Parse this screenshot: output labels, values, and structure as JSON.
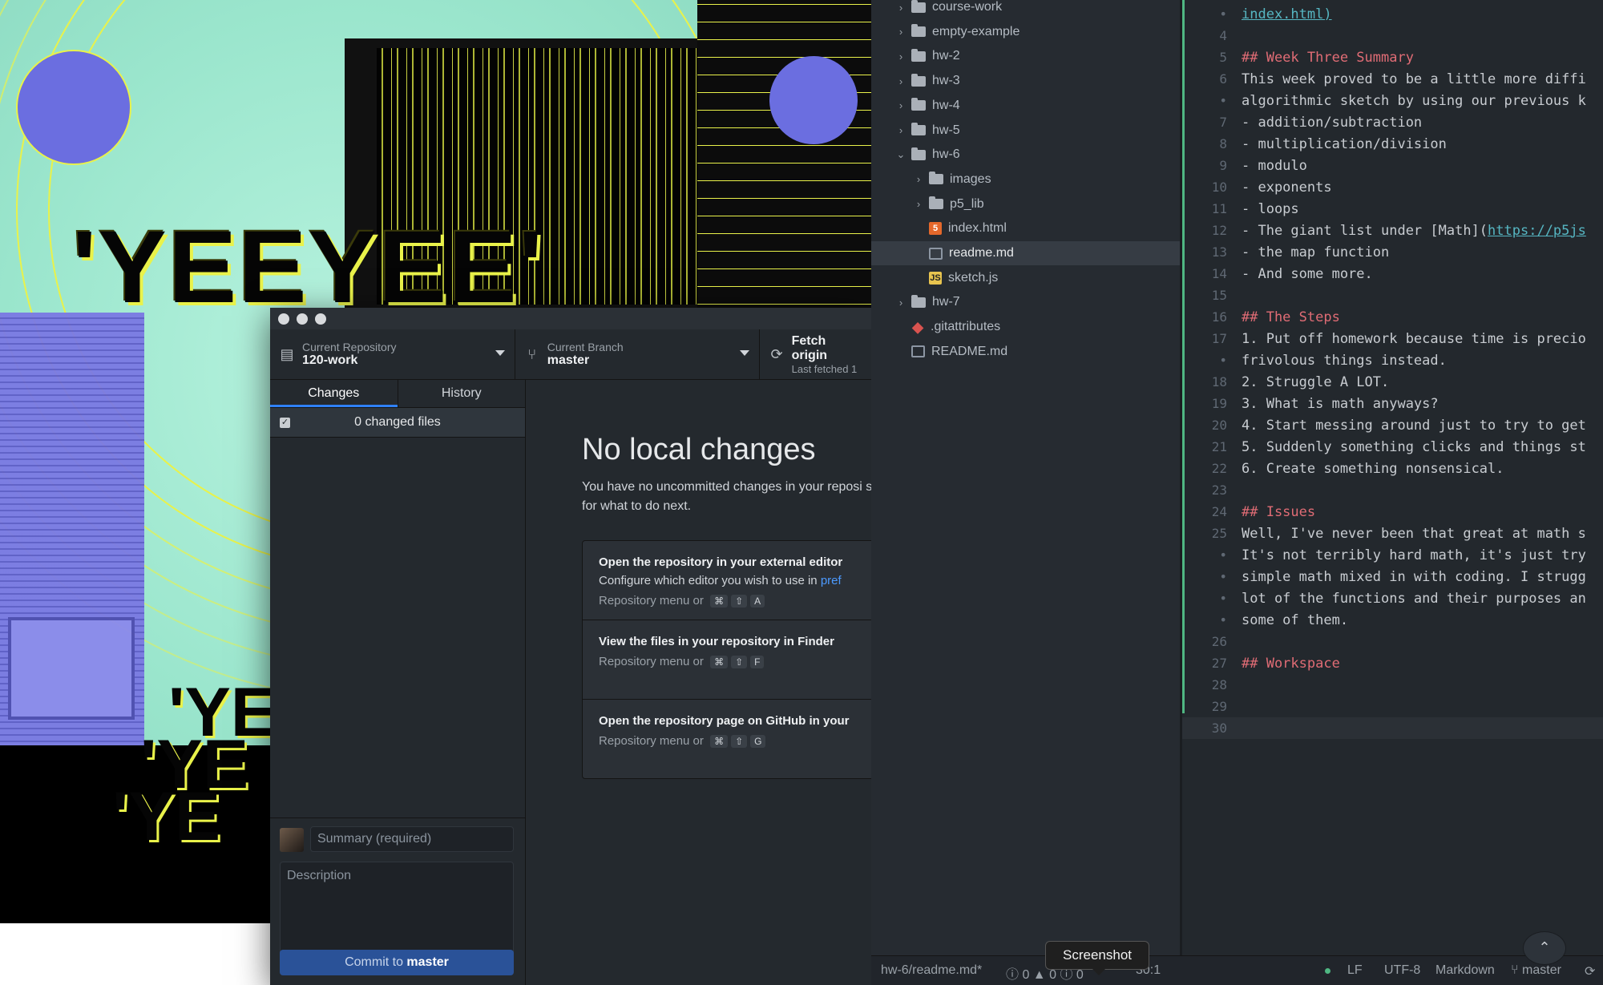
{
  "art": {
    "big_text": "'YEEYEE'",
    "small_text_1": "'YE",
    "small_text_2": "'YE",
    "small_text_3": "'YE"
  },
  "github_desktop": {
    "toolbar": {
      "repo_label": "Current Repository",
      "repo_value": "120-work",
      "branch_label": "Current Branch",
      "branch_value": "master",
      "fetch_label": "Fetch origin",
      "fetch_sub": "Last fetched 1"
    },
    "tabs": [
      "Changes",
      "History"
    ],
    "changed_files": "0 changed files",
    "summary_placeholder": "Summary (required)",
    "description_placeholder": "Description",
    "commit_prefix": "Commit to ",
    "commit_branch": "master",
    "no_changes_title": "No local changes",
    "no_changes_desc": "You have no uncommitted changes in your reposi suggestions for what to do next.",
    "actions": [
      {
        "title": "Open the repository in your external editor",
        "sub_prefix": "Configure which editor you wish to use in ",
        "sub_link": "pref",
        "menu": "Repository menu or",
        "keys": [
          "⌘",
          "⇧",
          "A"
        ]
      },
      {
        "title": "View the files in your repository in Finder",
        "menu": "Repository menu or",
        "keys": [
          "⌘",
          "⇧",
          "F"
        ]
      },
      {
        "title": "Open the repository page on GitHub in your",
        "menu": "Repository menu or",
        "keys": [
          "⌘",
          "⇧",
          "G"
        ]
      }
    ]
  },
  "atom": {
    "tree": [
      {
        "name": "course-work",
        "type": "folder",
        "depth": 0,
        "expanded": false
      },
      {
        "name": "empty-example",
        "type": "folder",
        "depth": 0,
        "expanded": false
      },
      {
        "name": "hw-2",
        "type": "folder",
        "depth": 0,
        "expanded": false
      },
      {
        "name": "hw-3",
        "type": "folder",
        "depth": 0,
        "expanded": false
      },
      {
        "name": "hw-4",
        "type": "folder",
        "depth": 0,
        "expanded": false
      },
      {
        "name": "hw-5",
        "type": "folder",
        "depth": 0,
        "expanded": false
      },
      {
        "name": "hw-6",
        "type": "folder",
        "depth": 0,
        "expanded": true
      },
      {
        "name": "images",
        "type": "folder",
        "depth": 1,
        "expanded": false
      },
      {
        "name": "p5_lib",
        "type": "folder",
        "depth": 1,
        "expanded": false
      },
      {
        "name": "index.html",
        "type": "html",
        "depth": 1
      },
      {
        "name": "readme.md",
        "type": "md",
        "depth": 1,
        "selected": true
      },
      {
        "name": "sketch.js",
        "type": "js",
        "depth": 1
      },
      {
        "name": "hw-7",
        "type": "folder",
        "depth": 0,
        "expanded": false
      },
      {
        "name": ".gitattributes",
        "type": "git",
        "depth": 0
      },
      {
        "name": "README.md",
        "type": "md",
        "depth": 0
      }
    ],
    "lines": [
      {
        "n": "•",
        "text": "index.html)",
        "kind": "link"
      },
      {
        "n": "4",
        "text": "",
        "kind": "plain"
      },
      {
        "n": "5",
        "text": "## Week Three Summary",
        "kind": "heading"
      },
      {
        "n": "6",
        "text": "This week proved to be a little more diffi",
        "kind": "plain"
      },
      {
        "n": "•",
        "text": "algorithmic sketch by using our previous k",
        "kind": "plain"
      },
      {
        "n": "7",
        "text": "- addition/subtraction",
        "kind": "plain"
      },
      {
        "n": "8",
        "text": "- multiplication/division",
        "kind": "plain"
      },
      {
        "n": "9",
        "text": "- modulo",
        "kind": "plain"
      },
      {
        "n": "10",
        "text": "- exponents",
        "kind": "plain"
      },
      {
        "n": "11",
        "text": "- loops",
        "kind": "plain"
      },
      {
        "n": "12",
        "text": "- The giant list under [Math](https://p5js",
        "kind": "mathlink"
      },
      {
        "n": "13",
        "text": "- the map function",
        "kind": "plain"
      },
      {
        "n": "14",
        "text": "- And some more.",
        "kind": "plain"
      },
      {
        "n": "15",
        "text": "",
        "kind": "plain"
      },
      {
        "n": "16",
        "text": "## The Steps",
        "kind": "heading"
      },
      {
        "n": "17",
        "text": "1. Put off homework because time is precio",
        "kind": "plain"
      },
      {
        "n": "•",
        "text": "frivolous things instead.",
        "kind": "plain"
      },
      {
        "n": "18",
        "text": "2. Struggle A LOT.",
        "kind": "plain"
      },
      {
        "n": "19",
        "text": "3. What is math anyways?",
        "kind": "plain"
      },
      {
        "n": "20",
        "text": "4. Start messing around just to try to get",
        "kind": "plain"
      },
      {
        "n": "21",
        "text": "5. Suddenly something clicks and things st",
        "kind": "plain"
      },
      {
        "n": "22",
        "text": "6. Create something nonsensical.",
        "kind": "plain"
      },
      {
        "n": "23",
        "text": "",
        "kind": "plain"
      },
      {
        "n": "24",
        "text": "## Issues",
        "kind": "heading"
      },
      {
        "n": "25",
        "text": "Well, I've never been that great at math s",
        "kind": "plain"
      },
      {
        "n": "•",
        "text": "It's not terribly hard math, it's just try",
        "kind": "plain"
      },
      {
        "n": "•",
        "text": "simple math mixed in with coding. I strugg",
        "kind": "plain"
      },
      {
        "n": "•",
        "text": "lot of the functions and their purposes an",
        "kind": "plain"
      },
      {
        "n": "•",
        "text": "some of them.",
        "kind": "plain"
      },
      {
        "n": "26",
        "text": "",
        "kind": "plain"
      },
      {
        "n": "27",
        "text": "## Workspace",
        "kind": "heading"
      },
      {
        "n": "28",
        "text": "",
        "kind": "plain"
      },
      {
        "n": "29",
        "text": "",
        "kind": "plain"
      },
      {
        "n": "30",
        "text": "",
        "kind": "cursor"
      }
    ],
    "status": {
      "file": "hw-6/readme.md*",
      "errors": "0",
      "warnings": "0",
      "infos": "0",
      "position": "30:1",
      "line_ending": "LF",
      "encoding": "UTF-8",
      "grammar": "Markdown",
      "branch": "master"
    }
  },
  "tooltip": "Screenshot"
}
